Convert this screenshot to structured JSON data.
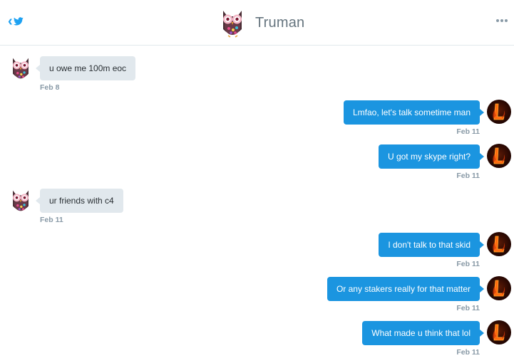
{
  "header": {
    "title": "Truman",
    "back_icon": "chevron-left-icon",
    "brand_icon": "twitter-bird-icon",
    "more_icon": "more-dots-icon",
    "accent_color": "#1da1f2"
  },
  "colors": {
    "outgoing_bubble": "#1b95e0",
    "incoming_bubble": "#e1e8ed",
    "timestamp": "#8899a6"
  },
  "messages": [
    {
      "direction": "in",
      "text": "u owe me 100m eoc",
      "date": "Feb 8"
    },
    {
      "direction": "out",
      "text": "Lmfao, let's talk sometime man",
      "date": "Feb 11"
    },
    {
      "direction": "out",
      "text": "U got my skype right?",
      "date": "Feb 11"
    },
    {
      "direction": "in",
      "text": "ur friends with c4",
      "date": "Feb 11"
    },
    {
      "direction": "out",
      "text": "I don't talk to that skid",
      "date": "Feb 11"
    },
    {
      "direction": "out",
      "text": "Or any stakers really for that matter",
      "date": "Feb 11"
    },
    {
      "direction": "out",
      "text": "What made u think that lol",
      "date": "Feb 11"
    }
  ]
}
